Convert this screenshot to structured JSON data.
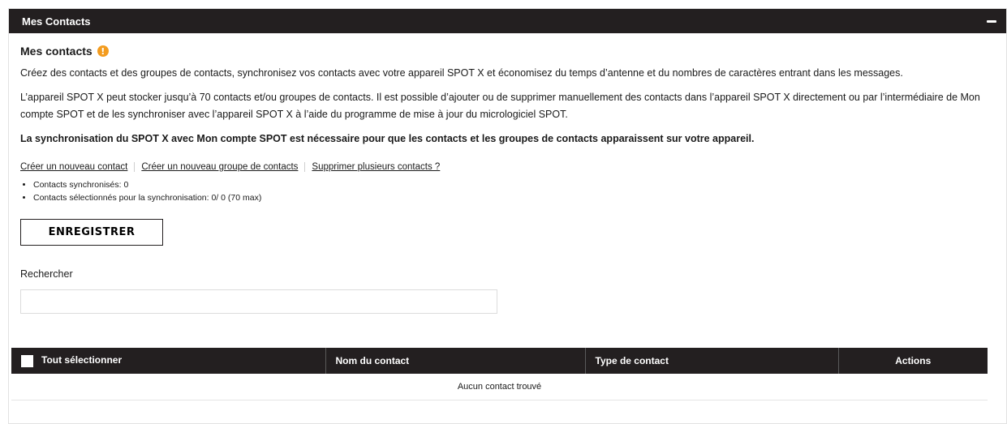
{
  "panel": {
    "title": "Mes Contacts",
    "collapse_icon": "minus-icon"
  },
  "section": {
    "title": "Mes contacts",
    "info_icon_glyph": "!",
    "info_icon_color": "#f39c1f",
    "paragraph1": "Créez des contacts et des groupes de contacts, synchronisez vos contacts avec votre appareil SPOT X et économisez du temps d’antenne et du nombres de caractères entrant dans les messages.",
    "paragraph2": "L’appareil SPOT X peut stocker jusqu’à 70 contacts et/ou groupes de contacts. Il est possible d’ajouter ou de supprimer manuellement des contacts dans l’appareil SPOT X directement ou par l’intermédiaire de Mon compte SPOT et de les synchroniser avec l’appareil SPOT X à l’aide du programme de mise à jour du micrologiciel SPOT.",
    "paragraph3": "La synchronisation du SPOT X avec Mon compte SPOT est nécessaire pour que les contacts et les groupes de contacts apparaissent sur votre appareil."
  },
  "links": {
    "new_contact": "Créer un nouveau contact",
    "new_group": "Créer un nouveau groupe de contacts",
    "delete_multiple": "Supprimer plusieurs contacts ?"
  },
  "stats": {
    "synced": "Contacts synchronisés: 0",
    "selected": "Contacts sélectionnés pour la synchronisation: 0/ 0 (70 max)"
  },
  "save_button": "ENREGISTRER",
  "search": {
    "label": "Rechercher",
    "value": "",
    "placeholder": ""
  },
  "table": {
    "headers": {
      "select_all": "Tout sélectionner",
      "name": "Nom du contact",
      "type": "Type de contact",
      "actions": "Actions"
    },
    "empty_message": "Aucun contact trouvé"
  },
  "colors": {
    "header_bg": "#231f20",
    "accent": "#f39c1f"
  }
}
